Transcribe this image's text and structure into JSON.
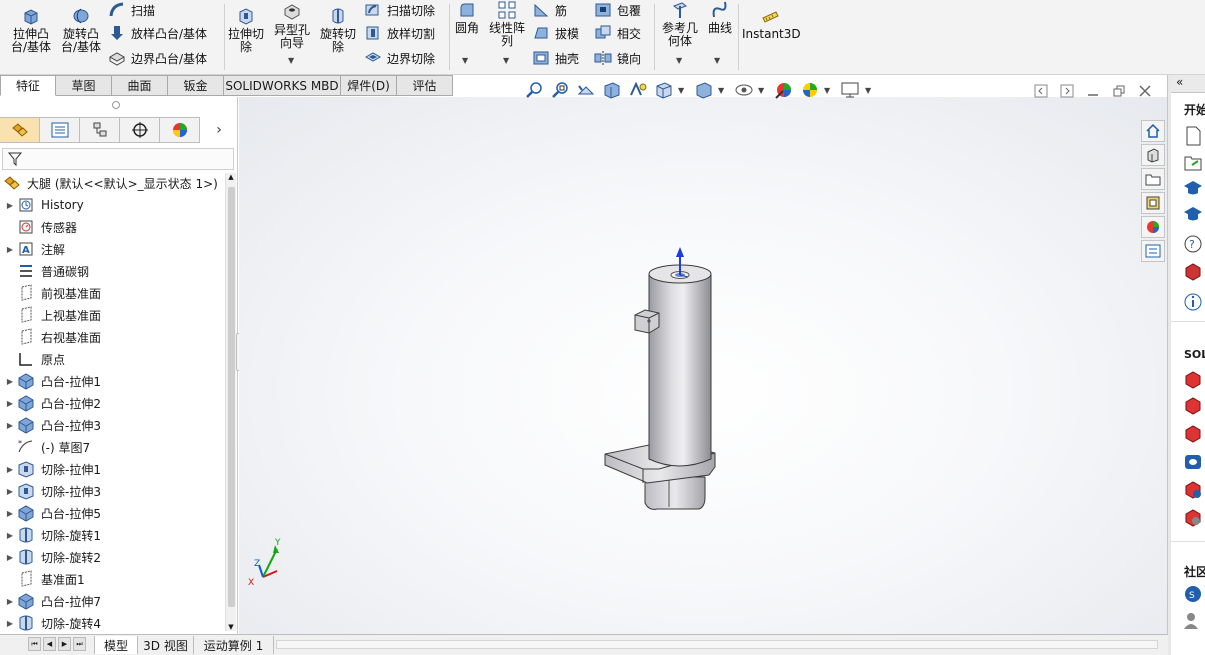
{
  "ribbon": {
    "extrude_boss": "拉伸凸\n台/基体",
    "revolve_boss": "旋转凸\n台/基体",
    "sweep": "扫描",
    "loft_boss": "放样凸台/基体",
    "boundary_boss": "边界凸台/基体",
    "extrude_cut": "拉伸切\n除",
    "hole_wizard": "异型孔\n向导",
    "revolve_cut": "旋转切\n除",
    "sweep_cut": "扫描切除",
    "loft_cut": "放样切割",
    "boundary_cut": "边界切除",
    "fillet": "圆角",
    "linear_pattern": "线性阵\n列",
    "rib": "筋",
    "draft": "拔模",
    "shell": "抽壳",
    "wrap": "包覆",
    "intersect": "相交",
    "mirror": "镜向",
    "ref_geometry": "参考几\n何体",
    "curves": "曲线",
    "instant3d": "Instant3D"
  },
  "command_tabs": [
    "特征",
    "草图",
    "曲面",
    "钣金",
    "SOLIDWORKS MBD",
    "焊件(D)",
    "评估"
  ],
  "feature_tree": {
    "root": "大腿 (默认<<默认>_显示状态 1>)",
    "items": [
      {
        "label": "History",
        "icon": "history-icon",
        "expand": true
      },
      {
        "label": "传感器",
        "icon": "sensor-icon",
        "expand": false
      },
      {
        "label": "注解",
        "icon": "annotation-icon",
        "expand": true
      },
      {
        "label": "普通碳钢",
        "icon": "material-icon",
        "expand": false
      },
      {
        "label": "前视基准面",
        "icon": "plane-icon",
        "expand": false
      },
      {
        "label": "上视基准面",
        "icon": "plane-icon",
        "expand": false
      },
      {
        "label": "右视基准面",
        "icon": "plane-icon",
        "expand": false
      },
      {
        "label": "原点",
        "icon": "origin-icon",
        "expand": false
      },
      {
        "label": "凸台-拉伸1",
        "icon": "boss-extrude-icon",
        "expand": true
      },
      {
        "label": "凸台-拉伸2",
        "icon": "boss-extrude-icon",
        "expand": true
      },
      {
        "label": "凸台-拉伸3",
        "icon": "boss-extrude-icon",
        "expand": true
      },
      {
        "label": "(-) 草图7",
        "icon": "sketch-icon",
        "expand": false
      },
      {
        "label": "切除-拉伸1",
        "icon": "cut-extrude-icon",
        "expand": true
      },
      {
        "label": "切除-拉伸3",
        "icon": "cut-extrude-icon",
        "expand": true
      },
      {
        "label": "凸台-拉伸5",
        "icon": "boss-extrude-icon",
        "expand": true
      },
      {
        "label": "切除-旋转1",
        "icon": "cut-revolve-icon",
        "expand": true
      },
      {
        "label": "切除-旋转2",
        "icon": "cut-revolve-icon",
        "expand": true
      },
      {
        "label": "基准面1",
        "icon": "plane-icon",
        "expand": false
      },
      {
        "label": "凸台-拉伸7",
        "icon": "boss-extrude-icon",
        "expand": true
      },
      {
        "label": "切除-旋转4",
        "icon": "cut-revolve-icon",
        "expand": true
      }
    ]
  },
  "bottom_tabs": [
    "模型",
    "3D 视图",
    "运动算例 1"
  ],
  "task_pane": {
    "section_open": "开始",
    "section_solidworks": "SOLI",
    "section_community": "社区"
  },
  "triad": {
    "x": "X",
    "y": "Y",
    "z": "Z"
  },
  "colors": {
    "accent": "#1f5fae",
    "selected_tab": "#f9e2b0",
    "model": "#b9b9bf"
  }
}
